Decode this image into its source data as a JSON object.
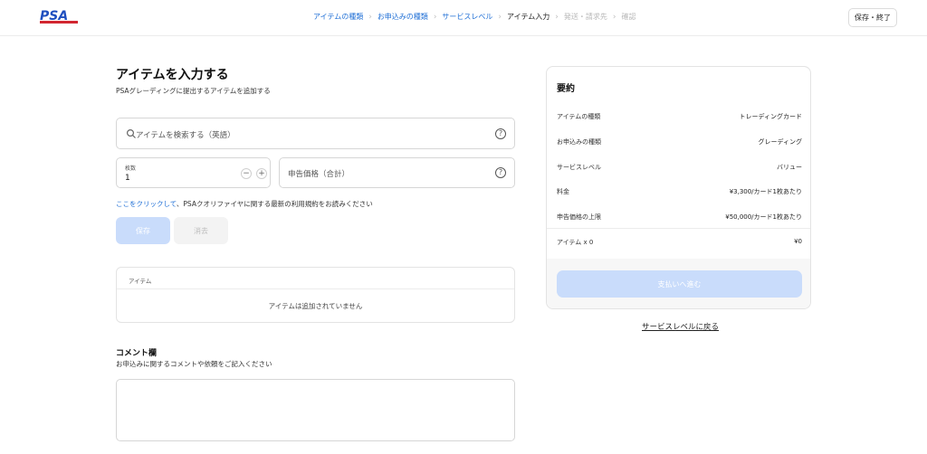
{
  "brand": {
    "logo_text": "PSA",
    "logo_color": "#1f4fbf",
    "logo_accent": "#d22630"
  },
  "header": {
    "steps": [
      {
        "label": "アイテムの種類",
        "state": "done"
      },
      {
        "label": "お申込みの種類",
        "state": "done"
      },
      {
        "label": "サービスレベル",
        "state": "done"
      },
      {
        "label": "アイテム入力",
        "state": "current"
      },
      {
        "label": "発送・請求先",
        "state": "future"
      },
      {
        "label": "確認",
        "state": "future"
      }
    ],
    "save_exit_label": "保存・終了"
  },
  "main": {
    "title": "アイテムを入力する",
    "subtitle": "PSAグレーディングに提出するアイテムを追加する",
    "search_placeholder": "アイテムを検索する（英語）",
    "quantity": {
      "label": "枚数",
      "value": "1",
      "minus": "−",
      "plus": "+"
    },
    "price_placeholder": "申告価格（合計）",
    "terms": {
      "link": "ここをクリックして",
      "text": "、PSAクオリファイヤに関する最新の利用規約をお読みください"
    },
    "save_label": "保存",
    "clear_label": "消去",
    "items_table": {
      "header": "アイテム",
      "empty": "アイテムは追加されていません"
    },
    "comment": {
      "title": "コメント欄",
      "subtitle": "お申込みに関するコメントや依頼をご記入ください"
    }
  },
  "summary": {
    "title": "要約",
    "rows": [
      {
        "label": "アイテムの種類",
        "value": "トレーディングカード"
      },
      {
        "label": "お申込みの種類",
        "value": "グレーディング"
      },
      {
        "label": "サービスレベル",
        "value": "バリュー"
      },
      {
        "label": "料金",
        "value": "¥3,300/カード1枚あたり"
      },
      {
        "label": "申告価格の上限",
        "value": "¥50,000/カード1枚あたり"
      },
      {
        "label": "アイテム x 0",
        "value": "¥0"
      }
    ],
    "pay_label": "支払いへ進む",
    "back_label": "サービスレベルに戻る"
  },
  "colors": {
    "accent": "#1f6fd6",
    "disabled_button": "#c9dcfb",
    "future_step": "#b8b8b8"
  },
  "icons": [
    "search-icon",
    "help-icon",
    "chevron-right-icon",
    "minus-icon",
    "plus-icon"
  ]
}
